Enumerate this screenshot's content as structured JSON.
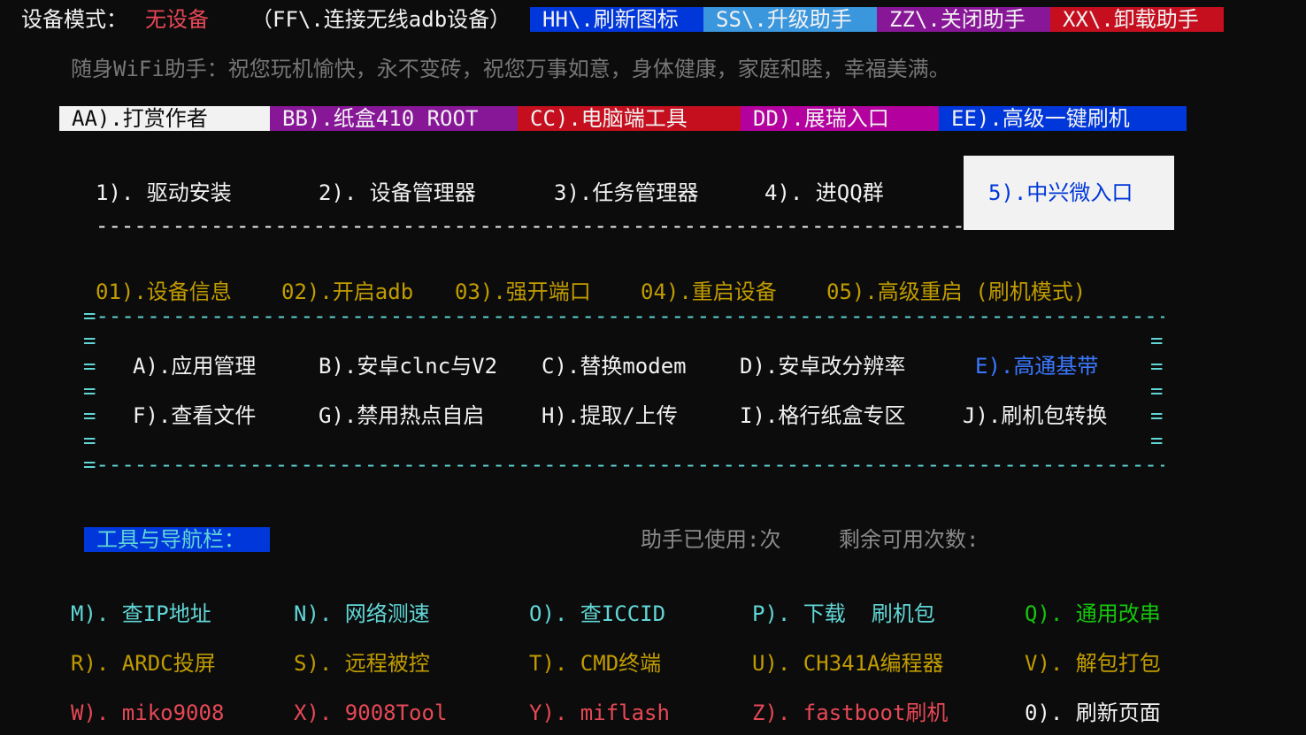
{
  "header": {
    "device_mode_label": "设备模式：",
    "device_mode_value": "无设备",
    "ff_link": "（FF\\.连接无线adb设备）",
    "hh": "HH\\.刷新图标",
    "ss": "SS\\.升级助手",
    "zz": "ZZ\\.关闭助手",
    "xx": "XX\\.卸载助手",
    "greeting": "随身WiFi助手：祝您玩机愉快，永不变砖，祝您万事如意，身体健康，家庭和睦，幸福美满。"
  },
  "top_menu": {
    "aa": "AA).打赏作者",
    "bb": "BB).纸盒410 ROOT",
    "cc": "CC).电脑端工具",
    "dd": "DD).展瑞入口",
    "ee": "EE).高级一键刷机"
  },
  "main_menu": {
    "item1": "1). 驱动安装",
    "item2": "2). 设备管理器",
    "item3": "3).任务管理器",
    "item4": "4). 进QQ群",
    "item5": "5).中兴微入口",
    "separator": "--------------------------------------------------------------------------------------"
  },
  "device_ops": {
    "op01": "01).设备信息",
    "op02": "02).开启adb",
    "op03": "03).强开端口",
    "op04": "04).重启设备",
    "op05": "05).高级重启 (刷机模式)"
  },
  "box": {
    "border": "=------------------------------------------------------------------------------------------------------=",
    "edge": "=",
    "row1": {
      "a": "A).应用管理",
      "b": "B).安卓clnc与V2",
      "c": "C).替换modem",
      "d": "D).安卓改分辨率",
      "e": "E).高通基带"
    },
    "row2": {
      "f": "F).查看文件",
      "g": "G).禁用热点自启",
      "h": "H).提取/上传",
      "i": "I).格行纸盒专区",
      "j": "J).刷机包转换"
    }
  },
  "nav": {
    "label": "工具与导航栏：",
    "usage": "助手已使用:次",
    "remaining": "剩余可用次数:"
  },
  "tools": {
    "row1": [
      "M). 查IP地址",
      "N). 网络测速",
      "O). 查ICCID",
      "P). 下载  刷机包",
      "Q). 通用改串"
    ],
    "row2": [
      "R). ARDC投屏",
      "S). 远程被控",
      "T). CMD终端",
      "U). CH341A编程器",
      "V). 解包打包"
    ],
    "row3": [
      "W). miko9008",
      "X). 9008Tool",
      "Y). miflash",
      "Z). fastboot刷机",
      "0). 刷新页面"
    ]
  },
  "colors": {
    "background": "#0c0c0c",
    "hh_bg": "#0037da",
    "ss_bg": "#3a96dd",
    "zz_bg": "#881798",
    "xx_bg": "#c50f1f",
    "aa_bg": "#f2f2f2",
    "bb_bg": "#881798",
    "cc_bg": "#c50f1f",
    "dd_bg": "#b4009e",
    "ee_bg": "#0037da",
    "selected_bg": "#f2f2f2",
    "nav_label_bg": "#0037da"
  }
}
